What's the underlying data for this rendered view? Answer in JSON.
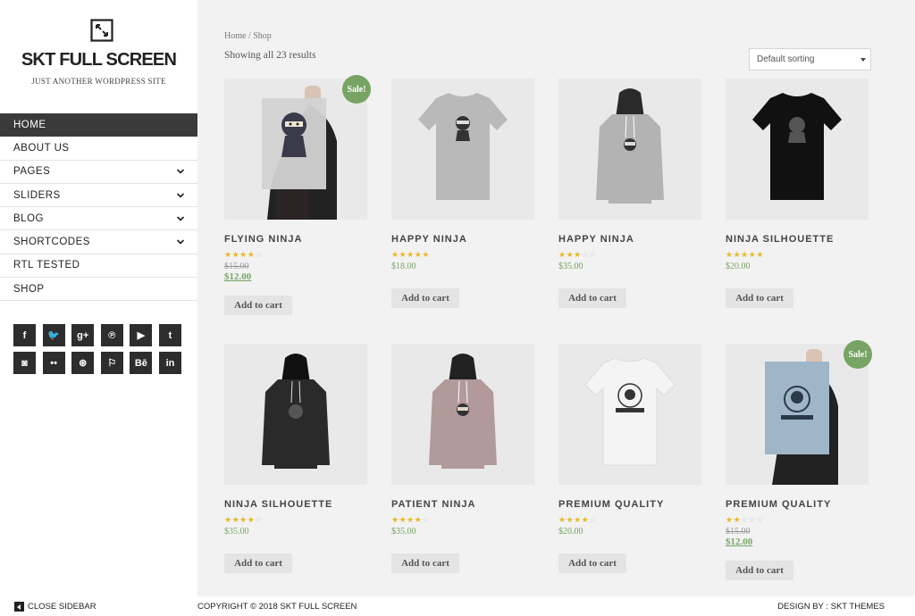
{
  "site": {
    "title": "SKT FULL SCREEN",
    "tagline": "JUST ANOTHER WORDPRESS SITE"
  },
  "nav": {
    "items": [
      {
        "label": "HOME",
        "active": true,
        "has_submenu": false
      },
      {
        "label": "ABOUT US",
        "active": false,
        "has_submenu": false
      },
      {
        "label": "PAGES",
        "active": false,
        "has_submenu": true
      },
      {
        "label": "SLIDERS",
        "active": false,
        "has_submenu": true
      },
      {
        "label": "BLOG",
        "active": false,
        "has_submenu": true
      },
      {
        "label": "SHORTCODES",
        "active": false,
        "has_submenu": true
      },
      {
        "label": "RTL TESTED",
        "active": false,
        "has_submenu": false
      },
      {
        "label": "SHOP",
        "active": false,
        "has_submenu": false
      }
    ]
  },
  "social": [
    {
      "name": "facebook-icon",
      "glyph": "f"
    },
    {
      "name": "twitter-icon",
      "glyph": "🐦"
    },
    {
      "name": "google-plus-icon",
      "glyph": "g+"
    },
    {
      "name": "pinterest-icon",
      "glyph": "℗"
    },
    {
      "name": "youtube-icon",
      "glyph": "▶"
    },
    {
      "name": "tumblr-icon",
      "glyph": "t"
    },
    {
      "name": "instagram-icon",
      "glyph": "◙"
    },
    {
      "name": "flickr-icon",
      "glyph": "••"
    },
    {
      "name": "dribbble-icon",
      "glyph": "⊛"
    },
    {
      "name": "foursquare-icon",
      "glyph": "⚐"
    },
    {
      "name": "behance-icon",
      "glyph": "Bē"
    },
    {
      "name": "linkedin-icon",
      "glyph": "in"
    }
  ],
  "shop": {
    "breadcrumb": "Home / Shop",
    "result_count": "Showing all 23 results",
    "sorting": {
      "selected": "Default sorting"
    },
    "cart_label": "Add to cart",
    "sale_label": "Sale!"
  },
  "products": [
    {
      "title": "FLYING NINJA",
      "rating": 4,
      "old_price": "$15.00",
      "price": "$12.00",
      "sale": true,
      "image": "poster-ninja"
    },
    {
      "title": "HAPPY NINJA",
      "rating": 5,
      "old_price": "",
      "price": "$18.00",
      "sale": false,
      "image": "tshirt-grey"
    },
    {
      "title": "HAPPY NINJA",
      "rating": 3,
      "old_price": "",
      "price": "$35.00",
      "sale": false,
      "image": "hoodie-grey"
    },
    {
      "title": "NINJA SILHOUETTE",
      "rating": 5,
      "old_price": "",
      "price": "$20.00",
      "sale": false,
      "image": "tshirt-black"
    },
    {
      "title": "NINJA SILHOUETTE",
      "rating": 4,
      "old_price": "",
      "price": "$35.00",
      "sale": false,
      "image": "hoodie-black"
    },
    {
      "title": "PATIENT NINJA",
      "rating": 4.5,
      "old_price": "",
      "price": "$35.00",
      "sale": false,
      "image": "hoodie-pink"
    },
    {
      "title": "PREMIUM QUALITY",
      "rating": 4.5,
      "old_price": "",
      "price": "$20.00",
      "sale": false,
      "image": "tshirt-white"
    },
    {
      "title": "PREMIUM QUALITY",
      "rating": 2,
      "old_price": "$15.00",
      "price": "$12.00",
      "sale": true,
      "image": "poster-woo"
    }
  ],
  "footer": {
    "close_sidebar": "CLOSE SIDEBAR",
    "copyright": "COPYRIGHT © 2018 SKT FULL SCREEN",
    "design_by": "DESIGN BY : SKT THEMES"
  },
  "colors": {
    "accent_green": "#77a464",
    "star_gold": "#e8b923",
    "nav_active_bg": "#3a3a3a"
  }
}
